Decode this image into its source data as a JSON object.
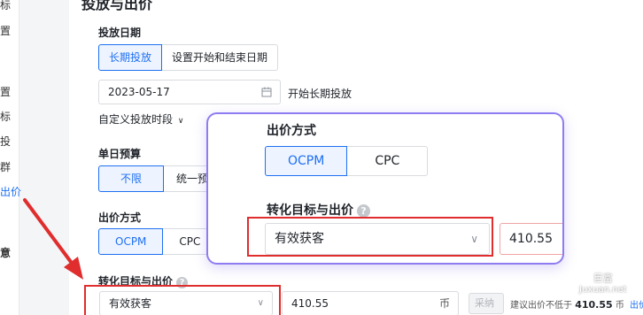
{
  "nav": {
    "items": [
      "标",
      "置",
      "置",
      "标",
      "投",
      "群",
      "出价",
      "意"
    ]
  },
  "panel": {
    "title": "投放与出价",
    "launch_date": {
      "label": "投放日期",
      "options": [
        "长期投放",
        "设置开始和结束日期"
      ],
      "date_value": "2023-05-17",
      "date_hint": "开始长期投放",
      "custom_period": "自定义投放时段"
    },
    "daily_budget": {
      "label": "单日预算",
      "options": [
        "不限",
        "统一预"
      ]
    },
    "bid_method": {
      "label": "出价方式",
      "options": [
        "OCPM",
        "CPC"
      ]
    },
    "goal": {
      "label": "转化目标与出价",
      "select_value": "有效获客",
      "bid_value": "410.55",
      "unit": "币",
      "adopt_button": "采纳",
      "suggestion": "建议出价不低于",
      "suggestion_value": "410.55",
      "suggestion_unit": "币",
      "link": "出价参"
    }
  },
  "popup": {
    "bid_method_label": "出价方式",
    "options": [
      "OCPM",
      "CPC"
    ],
    "goal_label": "转化目标与出价",
    "select_value": "有效获客",
    "bid_value": "410.55"
  },
  "watermark": {
    "line1": "巨富",
    "line2": "Juxuan.net"
  },
  "colors": {
    "accent": "#1d6ff2",
    "highlight": "#e02d2d",
    "popup_border": "#8e7cf1"
  }
}
